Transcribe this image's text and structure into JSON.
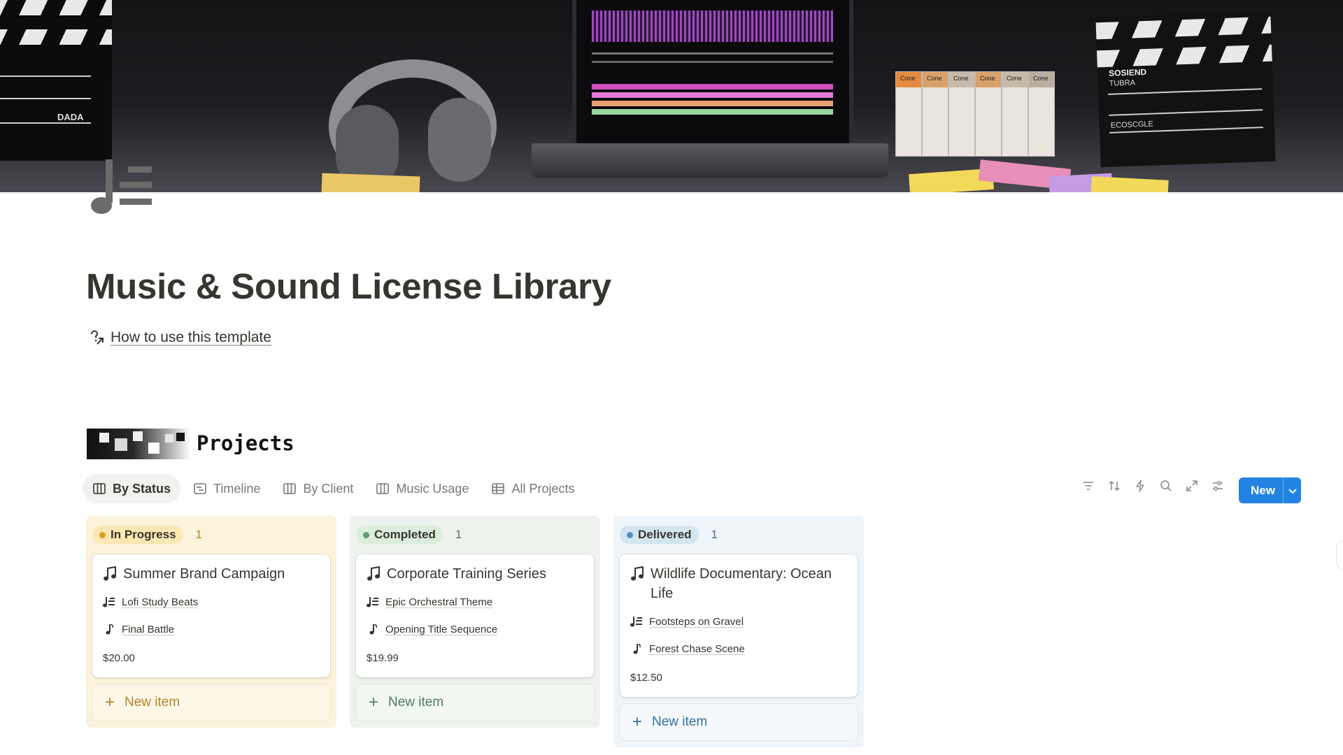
{
  "page": {
    "title": "Music & Sound License Library",
    "howto_link": "How to use this template"
  },
  "cover": {
    "clapper_left_text": [
      "DADA"
    ],
    "clapper_right_text": [
      "SOSIEND",
      "TUBRA",
      "ECOSCGLE"
    ],
    "book_spines": [
      "Cone",
      "Cone",
      "Cone",
      "Cone",
      "Cone",
      "Cone"
    ]
  },
  "projects": {
    "heading": "Projects",
    "tabs": [
      {
        "label": "By Status",
        "icon": "board-icon",
        "active": true
      },
      {
        "label": "Timeline",
        "icon": "timeline-icon",
        "active": false
      },
      {
        "label": "By Client",
        "icon": "board-icon",
        "active": false
      },
      {
        "label": "Music Usage",
        "icon": "board-icon",
        "active": false
      },
      {
        "label": "All Projects",
        "icon": "table-icon",
        "active": false
      }
    ],
    "toolbar_icons": [
      "filter-icon",
      "sort-icon",
      "automation-icon",
      "search-icon",
      "expand-icon",
      "settings-icon"
    ],
    "new_button": "New",
    "columns": [
      {
        "status": "In Progress",
        "count": "1",
        "colors": {
          "bg": "#fbf3db",
          "pill": "#fbe7b4",
          "dot": "#d9a01c",
          "accent": "#b5842a"
        },
        "card": {
          "title": "Summer Brand Campaign",
          "track": "Lofi Study Beats",
          "scene": "Final Battle",
          "price": "$20.00"
        },
        "new_item": "New item"
      },
      {
        "status": "Completed",
        "count": "1",
        "colors": {
          "bg": "#edf3ec",
          "pill": "#dbeddb",
          "dot": "#5a9e6f",
          "accent": "#4f7a5e"
        },
        "card": {
          "title": "Corporate Training Series",
          "track": "Epic Orchestral Theme",
          "scene": "Opening Title Sequence",
          "price": "$19.99"
        },
        "new_item": "New item"
      },
      {
        "status": "Delivered",
        "count": "1",
        "colors": {
          "bg": "#eef4f8",
          "pill": "#d3e5ef",
          "dot": "#4b8fc8",
          "accent": "#35709b"
        },
        "card": {
          "title": "Wildlife Documentary: Ocean Life",
          "track": "Footsteps on Gravel",
          "scene": "Forest Chase Scene",
          "price": "$12.50"
        },
        "new_item": "New item"
      }
    ]
  }
}
